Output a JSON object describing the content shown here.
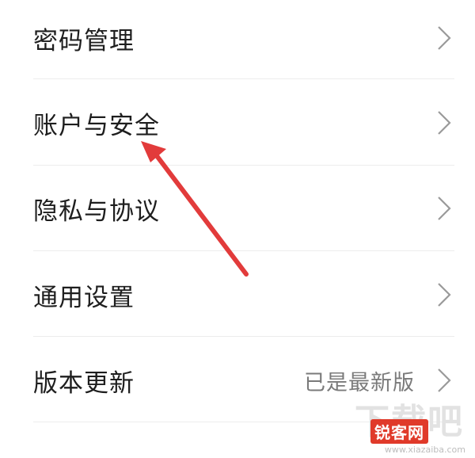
{
  "settings": {
    "items": [
      {
        "label": "密码管理",
        "value": ""
      },
      {
        "label": "账户与安全",
        "value": ""
      },
      {
        "label": "隐私与协议",
        "value": ""
      },
      {
        "label": "通用设置",
        "value": ""
      },
      {
        "label": "版本更新",
        "value": "已是最新版"
      }
    ],
    "chevron_icon": "chevron-right-icon"
  },
  "annotation": {
    "type": "arrow",
    "color": "#e23b3b",
    "points_to": "账户与安全"
  },
  "watermark": {
    "big_text": "下载吧",
    "badge_text": "锐客网",
    "url_text": "www.xiazaiba.com"
  }
}
